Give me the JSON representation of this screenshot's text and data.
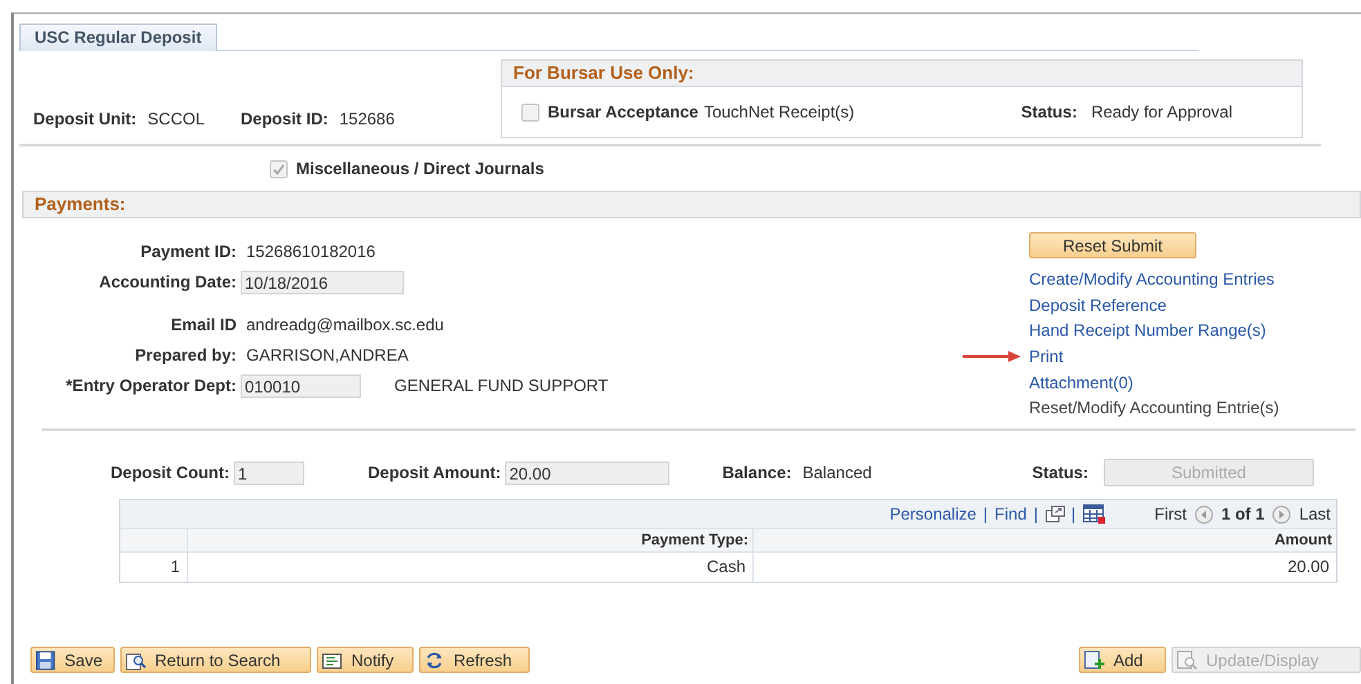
{
  "tab": {
    "label": "USC Regular Deposit",
    "selected": true
  },
  "header_fields": [
    {
      "label": "Deposit Unit:",
      "value": "SCCOL"
    },
    {
      "label": "Deposit ID:",
      "value": "152686"
    }
  ],
  "bursar_panel": {
    "title": "For Bursar Use Only:",
    "checkbox": {
      "label": "Bursar Acceptance",
      "checked": false
    },
    "receipt_text": "TouchNet Receipt(s)",
    "status_label": "Status:",
    "status_value": "Ready for Approval"
  },
  "misc_checkbox": {
    "label": "Miscellaneous / Direct Journals",
    "checked": true,
    "disabled": true
  },
  "payments": {
    "title": "Payments:",
    "fields": [
      {
        "kind": "text",
        "label": "Payment ID:",
        "value": "15268610182016"
      },
      {
        "kind": "input",
        "label": "Accounting Date:",
        "value": "10/18/2016"
      },
      {
        "kind": "text",
        "label": "Email ID",
        "value": "andreadg@mailbox.sc.edu"
      },
      {
        "kind": "text",
        "label": "Prepared by:",
        "value": "GARRISON,ANDREA"
      },
      {
        "kind": "input",
        "label": "*Entry Operator Dept:",
        "value": "010010",
        "description": "GENERAL FUND SUPPORT"
      }
    ],
    "reset_button": "Reset Submit",
    "links": [
      {
        "label": "Create/Modify Accounting Entries",
        "disabled": false,
        "arrow": false
      },
      {
        "label": "Deposit Reference",
        "disabled": false,
        "arrow": false
      },
      {
        "label": "Hand Receipt Number Range(s)",
        "disabled": false,
        "arrow": false
      },
      {
        "label": "Print",
        "disabled": false,
        "arrow": true
      },
      {
        "label": "Attachment(0)",
        "disabled": false,
        "arrow": false
      },
      {
        "label": "Reset/Modify Accounting Entrie(s)",
        "disabled": true,
        "arrow": false
      }
    ]
  },
  "summary": [
    {
      "kind": "input",
      "label": "Deposit Count:",
      "value": "1"
    },
    {
      "kind": "input",
      "label": "Deposit Amount:",
      "value": "20.00"
    },
    {
      "kind": "text",
      "label": "Balance:",
      "value": "Balanced"
    },
    {
      "kind": "button",
      "label": "Status:",
      "value": "Submitted"
    }
  ],
  "grid": {
    "toolbar": [
      {
        "kind": "link",
        "text": "Personalize"
      },
      {
        "kind": "separator",
        "text": "|"
      },
      {
        "kind": "link",
        "text": "Find"
      },
      {
        "kind": "separator",
        "text": "|"
      },
      {
        "kind": "new-window"
      },
      {
        "kind": "separator",
        "text": "|"
      },
      {
        "kind": "spreadsheet"
      }
    ],
    "pager": {
      "first": "First",
      "range": "1 of 1",
      "last": "Last"
    },
    "columns": [
      "Payment Type:",
      "Amount"
    ],
    "rows": [
      {
        "number": "1",
        "cells": [
          "Cash",
          "20.00"
        ]
      }
    ]
  },
  "buttons_left": [
    {
      "kind": "save",
      "label": "Save",
      "disabled": false
    },
    {
      "kind": "search",
      "label": "Return to Search",
      "disabled": false
    },
    {
      "kind": "notify",
      "label": "Notify",
      "disabled": false
    },
    {
      "kind": "refresh",
      "label": "Refresh",
      "disabled": false
    }
  ],
  "buttons_right": [
    {
      "kind": "add",
      "label": "Add",
      "disabled": false
    },
    {
      "kind": "update",
      "label": "Update/Display",
      "disabled": true
    }
  ]
}
